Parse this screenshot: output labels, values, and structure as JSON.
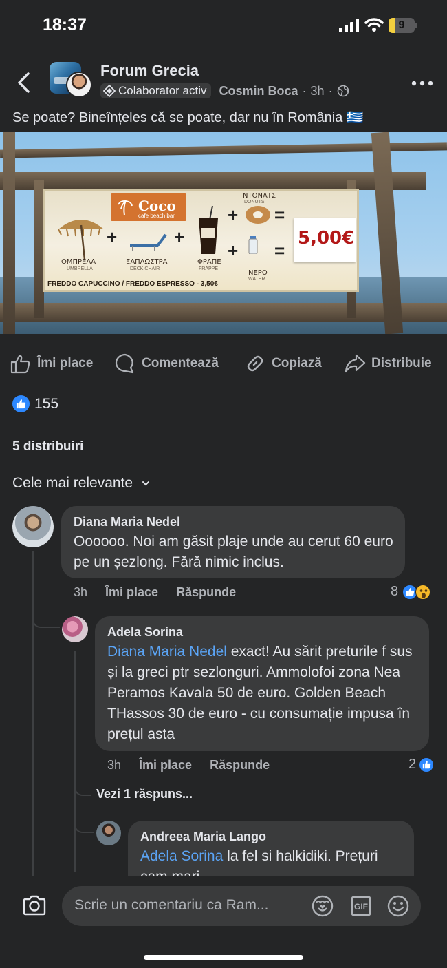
{
  "status_bar": {
    "time": "18:37",
    "battery": "9",
    "battery_level": 0.09
  },
  "header": {
    "group_name": "Forum Grecia",
    "badge_label": "Colaborator activ",
    "author": "Cosmin Boca",
    "time": "3h",
    "separator": "·"
  },
  "post": {
    "caption": "Se poate? Bineînțeles că se poate, dar nu în România 🇬🇷",
    "photo": {
      "brand": "Coco",
      "brand_sub": "cafe beach bar",
      "labels": [
        "ΟΜΠΡΕΛΑ",
        "ΞΑΠΛΩΣΤΡΑ",
        "ΦΡΑΠΕ",
        "ΝΤΟΝΑΤΣ",
        "ΝΕΡΟ"
      ],
      "sublabels": [
        "UMBRELLA",
        "DECK CHAIR",
        "FRAPPE",
        "DONUTS",
        "WATER"
      ],
      "price": "5,00€",
      "footer": "FREDDO CAPUCCINO / FREDDO ESPRESSO - 3,50€"
    }
  },
  "actions": {
    "like": "Îmi place",
    "comment": "Comentează",
    "copy": "Copiază",
    "share": "Distribuie"
  },
  "stats": {
    "reactions": "155",
    "shares": "5 distribuiri"
  },
  "sort_label": "Cele mai relevante",
  "comments": [
    {
      "name": "Diana Maria Nedel",
      "text": "Oooooo. Noi am găsit plaje unde au cerut 60 euro pe un șezlong. Fără nimic inclus.",
      "time": "3h",
      "like": "Îmi place",
      "reply": "Răspunde",
      "reactions": "8"
    },
    {
      "name": "Adela Sorina",
      "mention": "Diana Maria Nedel",
      "text": " exact! Au sărit preturile f sus și la greci ptr sezlonguri. Ammolofoi zona Nea Peramos Kavala 50 de euro. Golden  Beach THassos 30 de euro - cu consumație impusa în prețul asta",
      "time": "3h",
      "like": "Îmi place",
      "reply": "Răspunde",
      "reactions": "2"
    },
    {
      "name": "Andreea Maria Lango",
      "mention": "Adela Sorina",
      "text": " la fel si halkidiki. Prețuri cam mari"
    }
  ],
  "view_replies": "Vezi 1 răspuns...",
  "composer": {
    "placeholder": "Scrie un comentariu ca Ram..."
  },
  "icons": {
    "back": "chevron-left-icon",
    "more": "more-dots-icon",
    "globe": "globe-icon",
    "like": "thumbs-up-icon",
    "comment": "comment-bubble-icon",
    "copy": "link-icon",
    "share": "share-arrow-icon",
    "camera": "camera-icon",
    "sticker": "sticker-icon",
    "gif": "gif-icon",
    "emoji": "emoji-icon"
  },
  "colors": {
    "background": "#242526",
    "bubble": "#3a3b3c",
    "link": "#5ba4f5",
    "like_blue": "#2d88ff"
  }
}
